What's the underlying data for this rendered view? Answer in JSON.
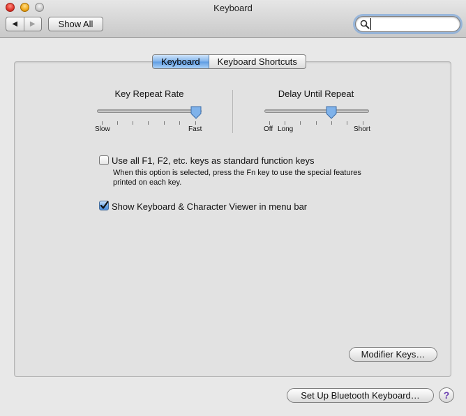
{
  "window": {
    "title": "Keyboard"
  },
  "toolbar": {
    "back_icon": "back-arrow-icon",
    "forward_icon": "forward-arrow-icon",
    "show_all_label": "Show All",
    "search": {
      "value": "",
      "placeholder": ""
    }
  },
  "tabs": [
    {
      "label": "Keyboard",
      "selected": true
    },
    {
      "label": "Keyboard Shortcuts",
      "selected": false
    }
  ],
  "key_repeat": {
    "title": "Key Repeat Rate",
    "min_label": "Slow",
    "max_label": "Fast",
    "level": 1.0
  },
  "delay_until_repeat": {
    "title": "Delay Until Repeat",
    "off_label": "Off",
    "long_label": "Long",
    "short_label": "Short",
    "level": 0.66
  },
  "options": {
    "function_keys": {
      "label": "Use all F1, F2, etc. keys as standard function keys",
      "description": "When this option is selected, press the Fn key to use the special features printed on each key.",
      "checked": false
    },
    "keyboard_viewer": {
      "label": "Show Keyboard & Character Viewer in menu bar",
      "checked": true
    }
  },
  "buttons": {
    "modifier_keys": "Modifier Keys…",
    "bluetooth": "Set Up Bluetooth Keyboard…",
    "help": "?"
  },
  "colors": {
    "accent": "#5e9ce3",
    "help_glyph": "#6b3fb0"
  }
}
